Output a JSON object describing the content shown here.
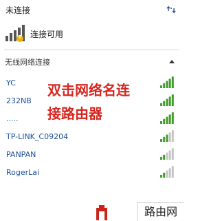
{
  "header": {
    "title": "未连接",
    "refresh_icon": "refresh-network-icon"
  },
  "status": {
    "label": "连接可用",
    "icon": "wireless-available-icon"
  },
  "section": {
    "title": "无线网络连接",
    "toggle_icon": "collapse-up-icon"
  },
  "networks": [
    {
      "name": "YC",
      "signal_bars": 5
    },
    {
      "name": "232NB",
      "signal_bars": 5
    },
    {
      "name": ".....",
      "signal_bars": 5
    },
    {
      "name": "TP-LINK_C09204",
      "signal_bars": 3
    },
    {
      "name": "PANPAN",
      "signal_bars": 2
    },
    {
      "name": "RogerLai",
      "signal_bars": 2
    }
  ],
  "annotation": {
    "line1": "双击网络名连",
    "line2": "接路由器"
  },
  "watermark": {
    "text": "路由网"
  },
  "colors": {
    "signal_on": "#3f9d2a",
    "signal_off": "#c4c4c4",
    "annotation": "#d6261f",
    "network_name": "#1c4f9c"
  }
}
